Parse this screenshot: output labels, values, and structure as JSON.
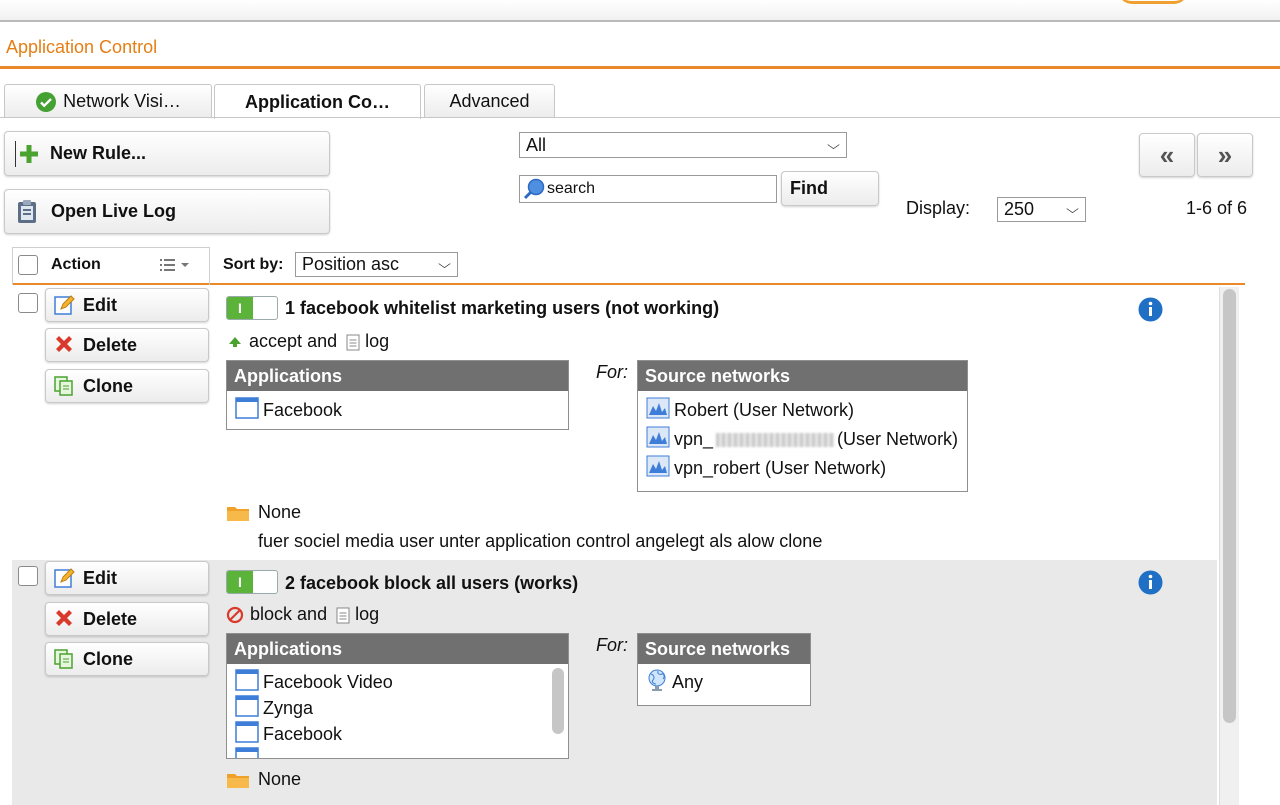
{
  "page": {
    "title": "Application Control"
  },
  "tabs": [
    {
      "label": "Network Visi…"
    },
    {
      "label": "Application Co…"
    },
    {
      "label": "Advanced"
    }
  ],
  "toolbar": {
    "new_rule": "New Rule...",
    "open_live_log": "Open Live Log",
    "filter_value": "All",
    "search_placeholder": "search",
    "find": "Find",
    "prev": "«",
    "next": "»",
    "display_label": "Display:",
    "display_value": "250",
    "pagination": "1-6 of 6"
  },
  "grid": {
    "action_header": "Action",
    "sort_label": "Sort by:",
    "sort_value": "Position asc"
  },
  "rules": [
    {
      "edit": "Edit",
      "delete": "Delete",
      "clone": "Clone",
      "name": "1 facebook whitelist marketing users (not working)",
      "action": "accept",
      "and": "and",
      "log": "log",
      "applications_header": "Applications",
      "applications": [
        "Facebook"
      ],
      "for": "For:",
      "sources_header": "Source networks",
      "sources": [
        "Robert (User Network)",
        "(User Network)",
        "vpn_robert (User Network)"
      ],
      "source2_prefix": "vpn_",
      "time": "None",
      "comment": "fuer sociel media user unter application control angelegt als alow clone"
    },
    {
      "edit": "Edit",
      "delete": "Delete",
      "clone": "Clone",
      "name": "2 facebook block all users (works)",
      "action": "block",
      "and": "and",
      "log": "log",
      "applications_header": "Applications",
      "applications": [
        "Facebook Video",
        "Zynga",
        "Facebook"
      ],
      "for": "For:",
      "sources_header": "Source networks",
      "sources": [
        "Any"
      ],
      "time": "None"
    }
  ],
  "colors": {
    "accent": "#e67e14",
    "toggle_on": "#5bb33a",
    "info": "#1f6fc5",
    "header": "#707070"
  }
}
